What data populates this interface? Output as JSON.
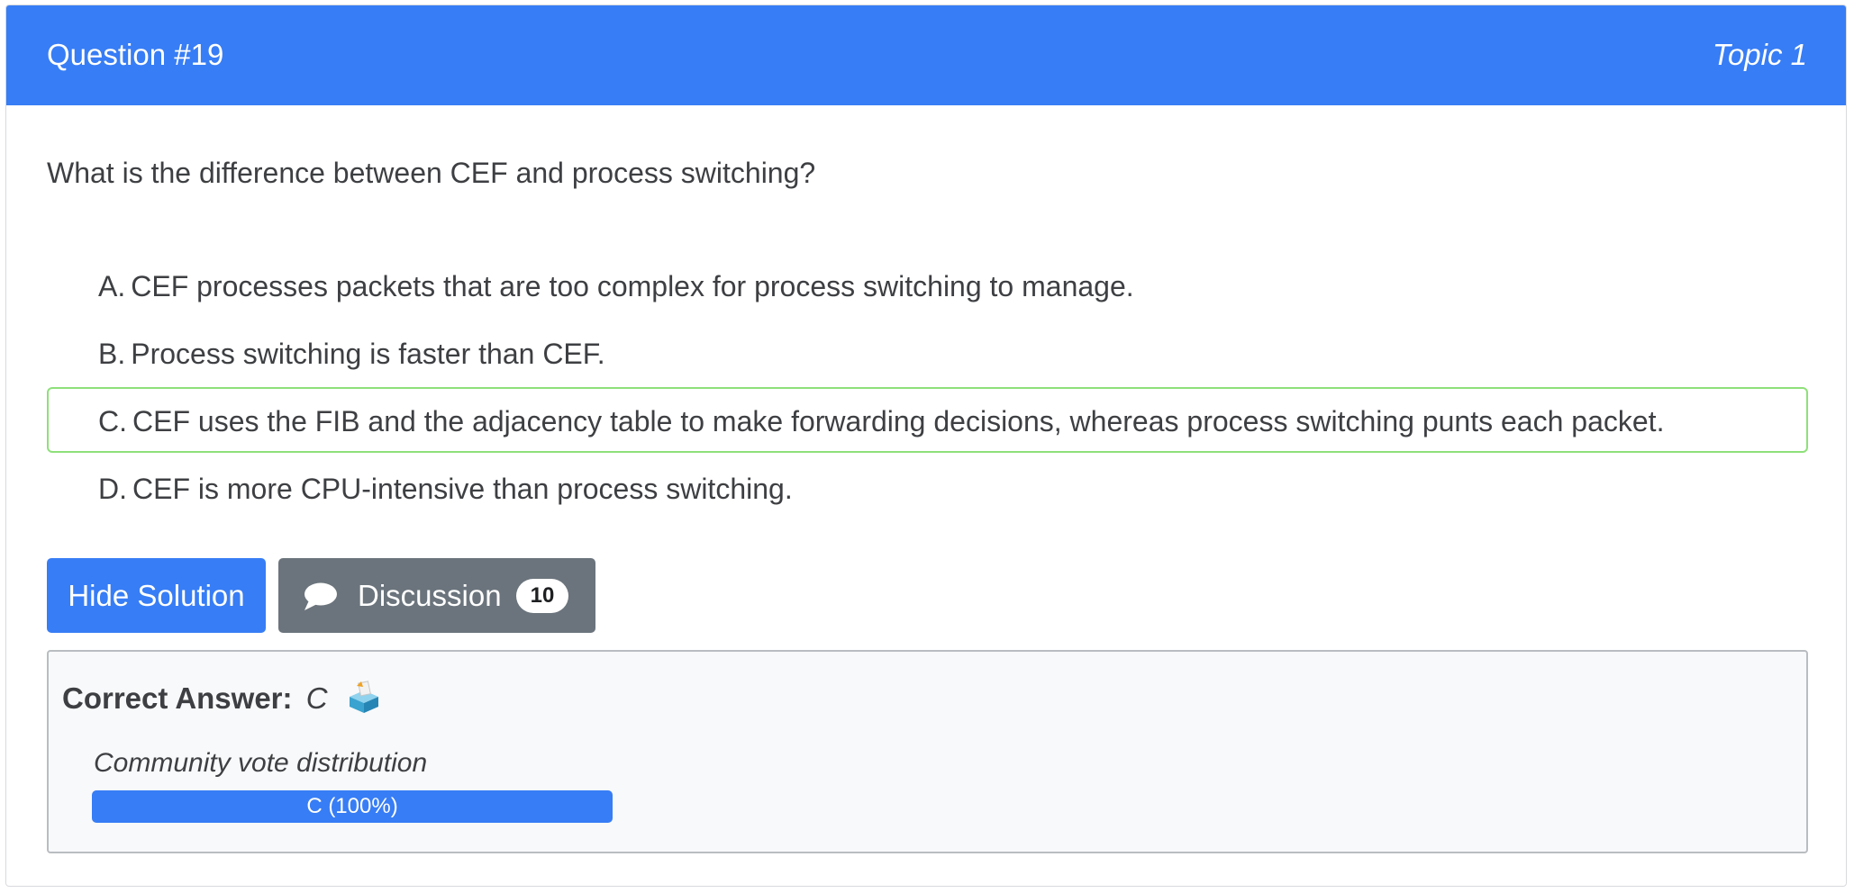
{
  "header": {
    "question_title": "Question #19",
    "topic": "Topic 1",
    "background_color": "#377df5"
  },
  "question": {
    "text": "What is the difference between CEF and process switching?"
  },
  "choices": [
    {
      "letter": "A.",
      "text": "CEF processes packets that are too complex for process switching to manage.",
      "correct": false
    },
    {
      "letter": "B.",
      "text": "Process switching is faster than CEF.",
      "correct": false
    },
    {
      "letter": "C.",
      "text": "CEF uses the FIB and the adjacency table to make forwarding decisions, whereas process switching punts each packet.",
      "correct": true
    },
    {
      "letter": "D.",
      "text": "CEF is more CPU-intensive than process switching.",
      "correct": false
    }
  ],
  "buttons": {
    "hide_solution": "Hide Solution",
    "discussion": "Discussion",
    "discussion_count": "10",
    "discussion_icon": "comment-icon"
  },
  "answer": {
    "label": "Correct Answer:",
    "value": "C",
    "icon": "ballot-box-icon"
  },
  "vote": {
    "title": "Community vote distribution",
    "options": [
      {
        "label": "C (100%)",
        "percent": 100
      }
    ],
    "bar_color": "#377df5"
  },
  "colors": {
    "correct_border": "#8ee07a",
    "discussion_button": "#6b747c"
  }
}
